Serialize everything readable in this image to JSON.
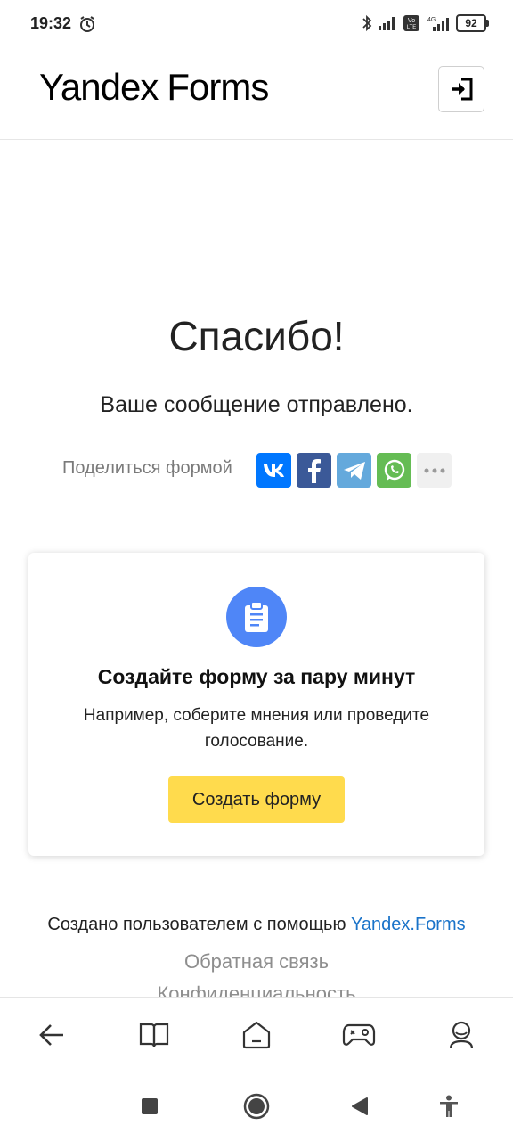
{
  "status_bar": {
    "time": "19:32",
    "battery": "92",
    "icons": [
      "alarm-icon",
      "bluetooth-icon",
      "signal-icon",
      "volte-icon",
      "4g-signal-icon",
      "battery-icon"
    ]
  },
  "header": {
    "logo_part1": "Yandex",
    "logo_part2": "Forms",
    "login_icon": "login-icon"
  },
  "main": {
    "title": "Спасибо!",
    "subtitle": "Ваше сообщение отправлено.",
    "share_label": "Поделиться формой",
    "share_buttons": [
      {
        "name": "vk",
        "color": "#0077ff"
      },
      {
        "name": "facebook",
        "color": "#3b5998"
      },
      {
        "name": "telegram",
        "color": "#64a9dc"
      },
      {
        "name": "whatsapp",
        "color": "#65bc54"
      },
      {
        "name": "more",
        "color": "#f0f0f0"
      }
    ]
  },
  "promo_card": {
    "icon": "clipboard-icon",
    "title": "Создайте форму за пару минут",
    "text": "Например, соберите мнения или проведите голосование.",
    "button_label": "Создать форму",
    "accent": "#ffdb4d",
    "icon_bg": "#4f86f7"
  },
  "footer": {
    "created_prefix": "Создано пользователем с помощью",
    "created_link": "Yandex.Forms",
    "feedback_link": "Обратная связь",
    "privacy_link": "Конфиденциальность"
  },
  "browser_toolbar": {
    "items": [
      "back-icon",
      "book-icon",
      "home-icon",
      "gamepad-icon",
      "profile-icon"
    ]
  },
  "nav_bar": {
    "items": [
      "recent-apps-icon",
      "home-circle-icon",
      "back-triangle-icon",
      "accessibility-icon"
    ]
  }
}
